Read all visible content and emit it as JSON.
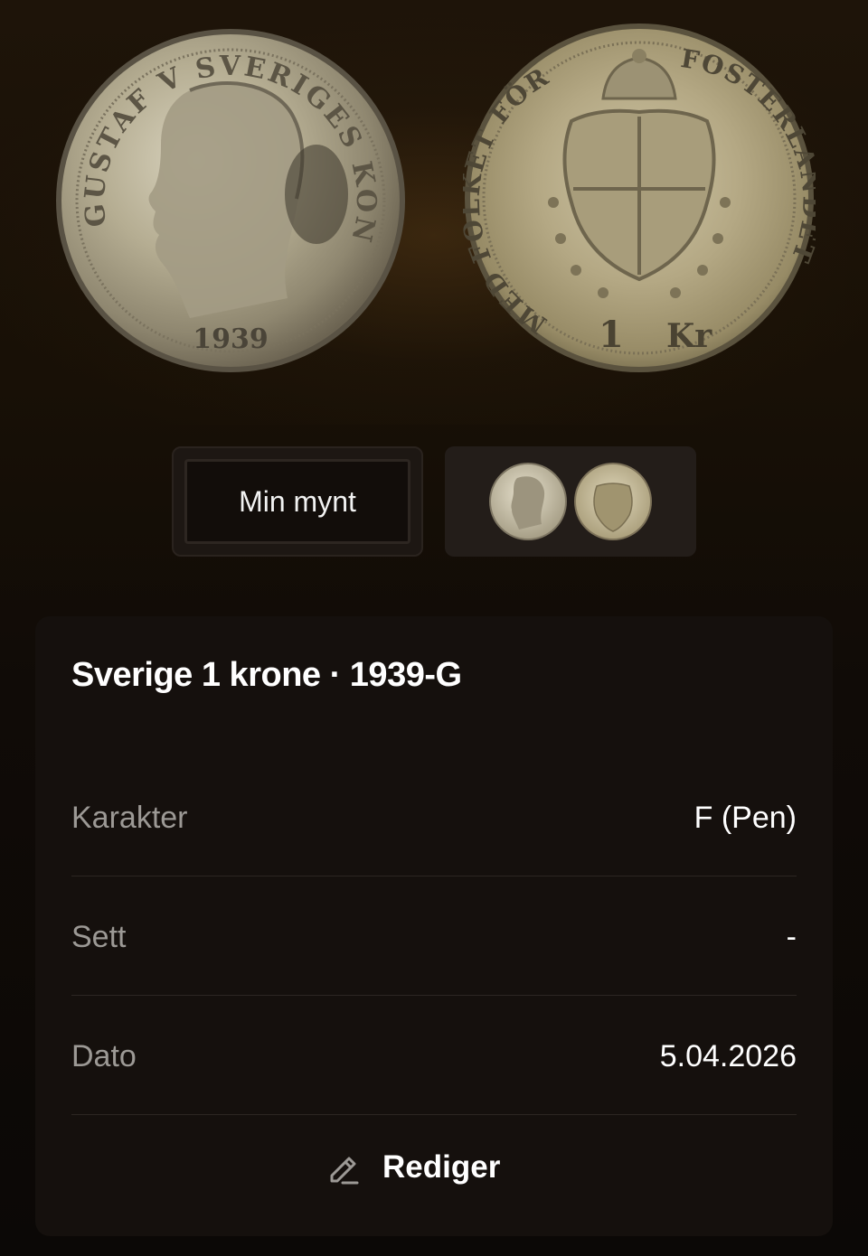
{
  "hero": {
    "obverse_legend": "GUSTAF V SVERIGES KONUNG",
    "obverse_year": "1939",
    "reverse_legend_left": "MED FOLKET FÖR",
    "reverse_legend_right": "FOSTERLANDET",
    "reverse_denomination": "1",
    "reverse_unit": "Kr"
  },
  "thumbnails": {
    "text_label": "Min mynt"
  },
  "coin": {
    "title": "Sverige 1 krone · 1939-G"
  },
  "details": [
    {
      "label": "Karakter",
      "value": "F (Pen)"
    },
    {
      "label": "Sett",
      "value": "-"
    },
    {
      "label": "Dato",
      "value": "5.04.2026"
    }
  ],
  "actions": {
    "edit_label": "Rediger",
    "edit_icon": "pencil-icon"
  },
  "colors": {
    "background": "#0c0806",
    "card": "#15100d",
    "label_text": "#9c9995",
    "value_text": "#ffffff",
    "divider": "#2c2622"
  }
}
